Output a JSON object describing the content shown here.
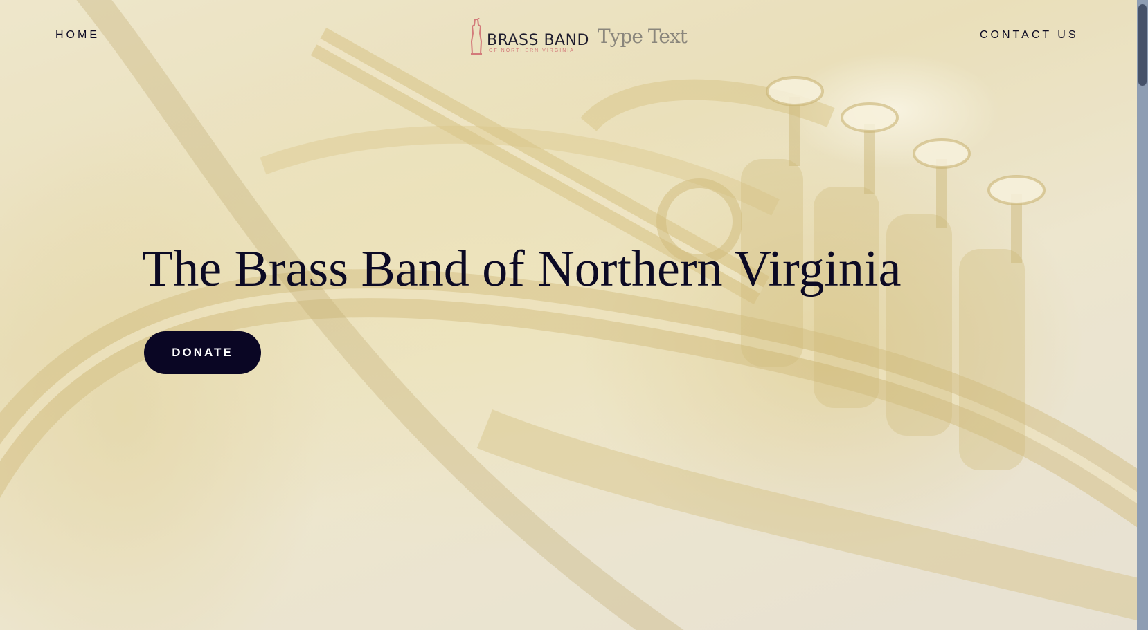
{
  "nav": {
    "home_label": "HOME",
    "contact_label": "CONTACT US"
  },
  "logo": {
    "name": "BRASS BAND",
    "subtitle": "OF NORTHERN VIRGINIA",
    "type_text": "Type Text"
  },
  "hero": {
    "title": "The Brass Band of Northern Virginia",
    "donate_label": "DONATE",
    "background_image": "brass-instrument-valves-photo"
  },
  "colors": {
    "text_dark": "#0c0a24",
    "button_bg": "#0a0624",
    "button_text": "#ffffff",
    "logo_accent": "#d37a7a",
    "scrollbar_track": "#8e9db3",
    "scrollbar_thumb": "#46526a"
  }
}
